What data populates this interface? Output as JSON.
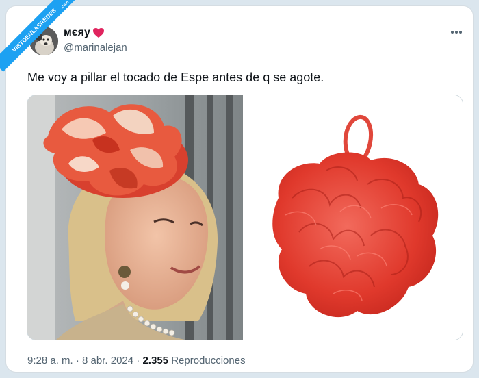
{
  "watermark": {
    "main": "VISTOENLASREDES",
    "sub": ".com"
  },
  "author": {
    "display_name": "мєяу",
    "handle": "@marinalejan"
  },
  "tweet": {
    "text": "Me voy a pillar el tocado de Espe antes de q se agote."
  },
  "media": {
    "left_image": "woman-with-red-fascinator-photo",
    "right_image": "red-bath-sponge-photo"
  },
  "meta": {
    "time": "9:28 a. m.",
    "separator": "·",
    "date": "8 abr. 2024",
    "views": "2.355",
    "views_label": "Reproducciones"
  },
  "colors": {
    "accent": "#1da1f2",
    "heart": "#e0245e",
    "secondary_text": "#536471"
  },
  "icons": {
    "more": "more-horizontal-icon",
    "heart": "heart-icon"
  }
}
